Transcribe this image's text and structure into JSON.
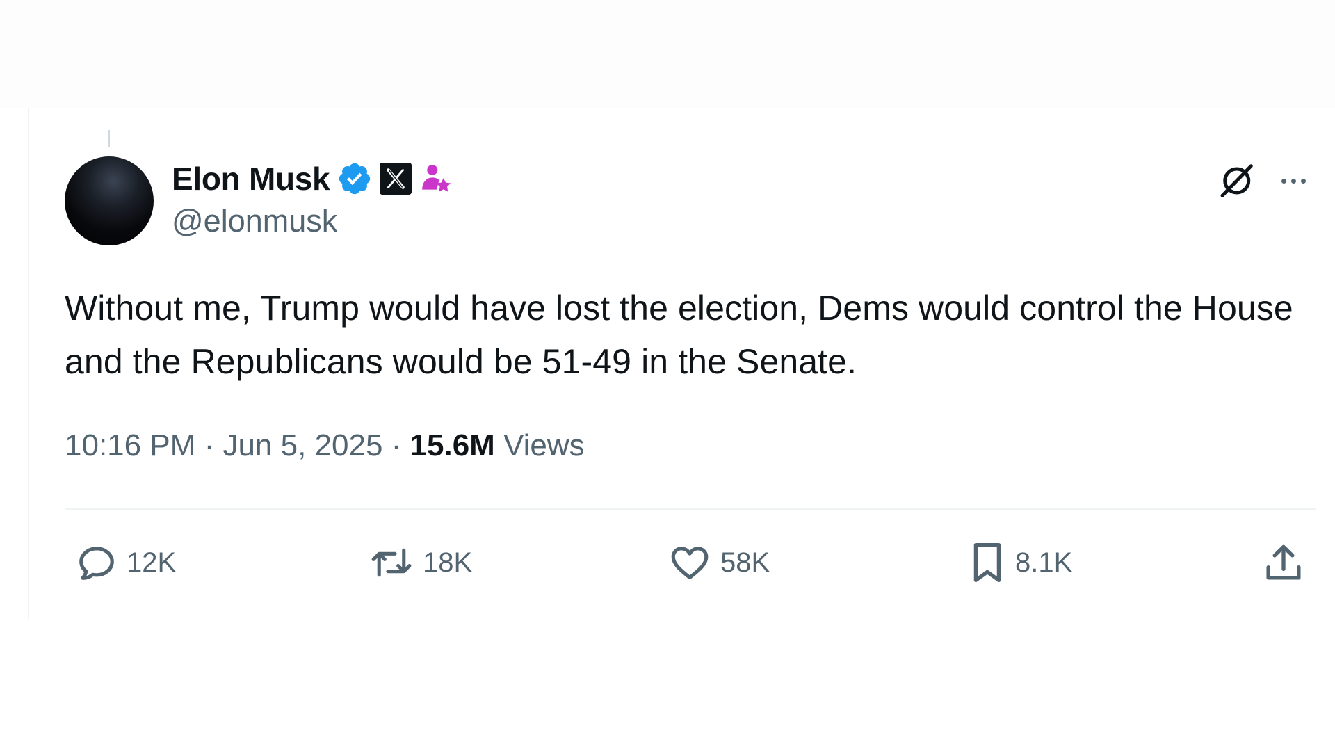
{
  "author": {
    "name": "Elon Musk",
    "handle": "@elonmusk",
    "verified_color": "#1d9bf0",
    "affiliate_color": "#c936c9",
    "icons": [
      "verified-badge-icon",
      "x-affiliate-icon",
      "subscriber-star-icon"
    ]
  },
  "header_actions": {
    "icons": [
      "grok-icon",
      "more-icon"
    ]
  },
  "tweet": {
    "text": "Without me, Trump would have lost the election, Dems would control the House and the Republicans would be 51-49 in the Senate."
  },
  "meta": {
    "time": "10:16 PM",
    "separator": " · ",
    "date": "Jun 5, 2025",
    "views_count": "15.6M",
    "views_label": "Views"
  },
  "actions": {
    "replies": "12K",
    "reposts": "18K",
    "likes": "58K",
    "bookmarks": "8.1K"
  },
  "colors": {
    "text_primary": "#0f1419",
    "text_secondary": "#536471",
    "divider": "#eff3f4"
  }
}
